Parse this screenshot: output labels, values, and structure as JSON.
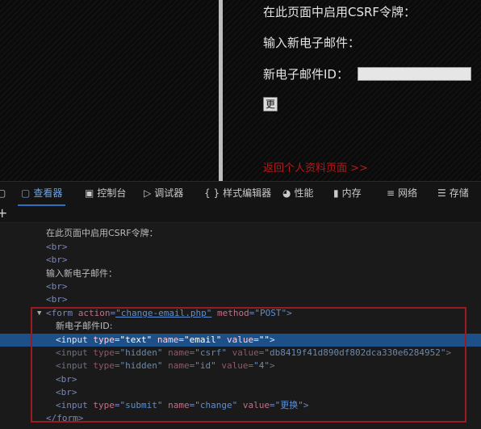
{
  "page": {
    "line1": "在此页面中启用CSRF令牌：",
    "line2": "输入新电子邮件：",
    "email_label": "新电子邮件ID：",
    "email_value": "",
    "change_button": "更换",
    "back_link": "返回个人资料页面 >>"
  },
  "devtools": {
    "tabs": [
      {
        "label": "查看器",
        "icon": "inspector-icon",
        "selected": true
      },
      {
        "label": "控制台",
        "icon": "console-icon",
        "selected": false
      },
      {
        "label": "调试器",
        "icon": "debugger-icon",
        "selected": false
      },
      {
        "label": "样式编辑器",
        "icon": "style-editor-icon",
        "selected": false
      },
      {
        "label": "性能",
        "icon": "performance-icon",
        "selected": false
      },
      {
        "label": "内存",
        "icon": "memory-icon",
        "selected": false
      },
      {
        "label": "网络",
        "icon": "network-icon",
        "selected": false
      },
      {
        "label": "存储",
        "icon": "storage-icon",
        "selected": false
      }
    ],
    "markup": {
      "text1": "在此页面中启用CSRF令牌：",
      "br": "<br>",
      "text2": "输入新电子邮件：",
      "form_open": {
        "tag": "<form",
        "attr1_name": "action",
        "attr1_value": "\"change-email.php\"",
        "attr2_name": "method",
        "attr2_value": "\"POST\"",
        "end": ">"
      },
      "form_text": "新电子邮件ID:",
      "input_email": {
        "tag": "<input",
        "type_name": "type",
        "type_value": "\"text\"",
        "name_name": "name",
        "name_value": "\"email\"",
        "value_name": "value",
        "value_value": "\"\"",
        "end": ">"
      },
      "input_csrf": {
        "tag": "<input",
        "type_name": "type",
        "type_value": "\"hidden\"",
        "name_name": "name",
        "name_value": "\"csrf\"",
        "value_name": "value",
        "value_value": "\"db8419f41d890df802dca330e6284952\"",
        "end": ">"
      },
      "input_id": {
        "tag": "<input",
        "type_name": "type",
        "type_value": "\"hidden\"",
        "name_name": "name",
        "name_value": "\"id\"",
        "value_name": "value",
        "value_value": "\"4\"",
        "end": ">"
      },
      "input_submit": {
        "tag": "<input",
        "type_name": "type",
        "type_value": "\"submit\"",
        "name_name": "name",
        "name_value": "\"change\"",
        "value_name": "value",
        "value_value": "\"更换\"",
        "end": ">"
      },
      "form_close": "</form>"
    }
  },
  "colors": {
    "highlight_border": "#9a1c22",
    "selected_row": "#1d4f88",
    "link": "#b31a1a"
  }
}
